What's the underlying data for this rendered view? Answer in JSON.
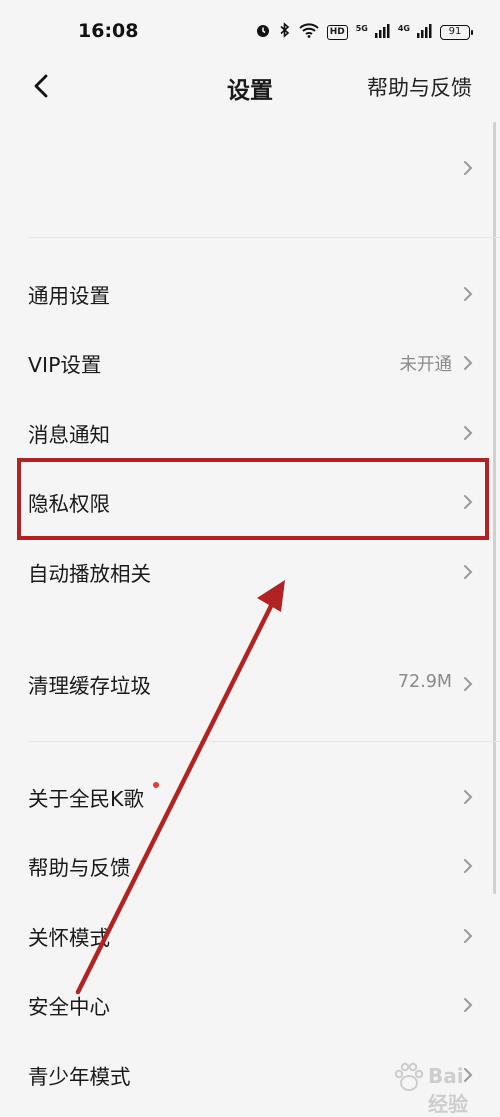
{
  "status_bar": {
    "time": "16:08",
    "hd_badge": "HD",
    "signal1_label": "5G",
    "signal2_label": "4G",
    "battery_level": "91"
  },
  "header": {
    "title": "设置",
    "help_link": "帮助与反馈"
  },
  "rows": {
    "general": {
      "label": "通用设置"
    },
    "vip": {
      "label": "VIP设置",
      "value": "未开通"
    },
    "notification": {
      "label": "消息通知"
    },
    "privacy": {
      "label": "隐私权限"
    },
    "autoplay": {
      "label": "自动播放相关"
    },
    "cache": {
      "label": "清理缓存垃圾",
      "value": "72.9M"
    },
    "about": {
      "label": "关于全民K歌"
    },
    "help": {
      "label": "帮助与反馈"
    },
    "care": {
      "label": "关怀模式"
    },
    "security": {
      "label": "安全中心"
    },
    "youth": {
      "label": "青少年模式"
    }
  },
  "watermark": {
    "text": "Bai 经验"
  },
  "colors": {
    "background": "#f5f5f5",
    "highlight_box": "#b22222",
    "arrow": "#b22222",
    "badge_dot": "#e53935"
  }
}
